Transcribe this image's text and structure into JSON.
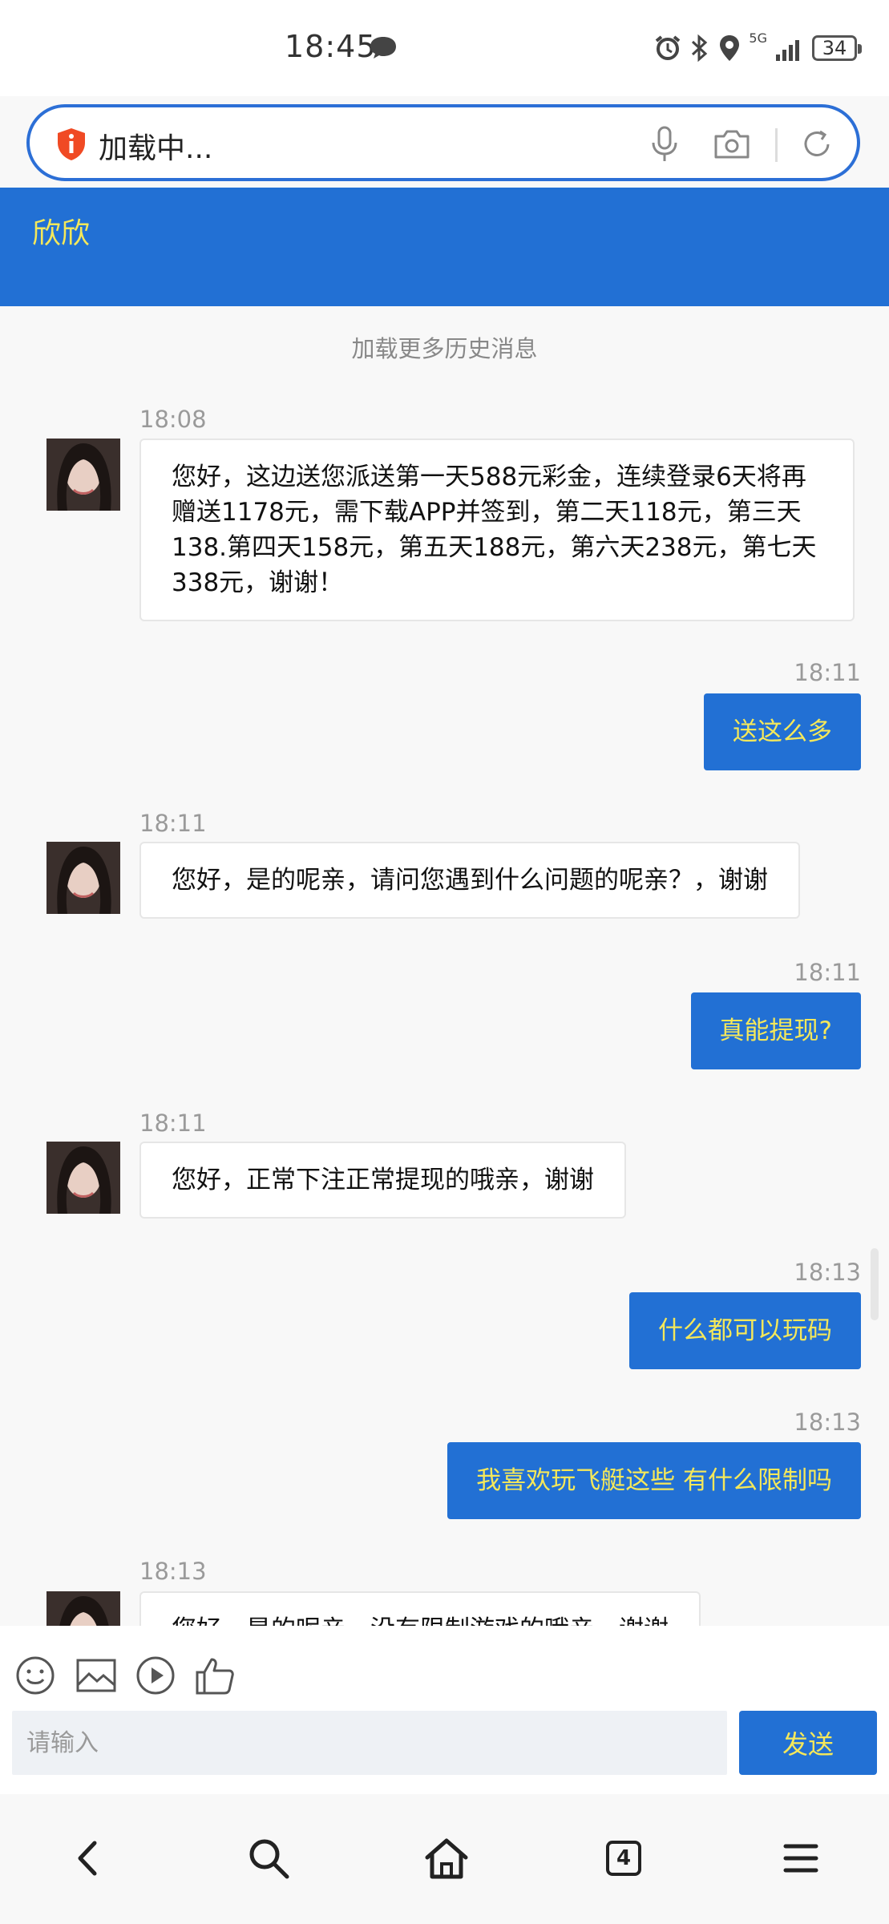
{
  "status_bar": {
    "time": "18:45",
    "network": "5G",
    "battery": "34",
    "icons": [
      "message-icon",
      "alarm-icon",
      "bluetooth-icon",
      "location-icon",
      "signal-icon",
      "battery-icon"
    ]
  },
  "browser": {
    "address_text": "加载中...",
    "tab_count": "4"
  },
  "chat": {
    "title": "欣欣",
    "load_more": "加载更多历史消息",
    "messages": [
      {
        "direction": "in",
        "time": "18:08",
        "text": "您好，这边送您派送第一天588元彩金，连续登录6天将再赠送1178元，需下载APP并签到，第二天118元，第三天138.第四天158元，第五天188元，第六天238元，第七天338元，谢谢！"
      },
      {
        "direction": "out",
        "time": "18:11",
        "text": "送这么多"
      },
      {
        "direction": "in",
        "time": "18:11",
        "text": "您好，是的呢亲，请问您遇到什么问题的呢亲？，谢谢"
      },
      {
        "direction": "out",
        "time": "18:11",
        "text": "真能提现?"
      },
      {
        "direction": "in",
        "time": "18:11",
        "text": "您好，正常下注正常提现的哦亲，谢谢"
      },
      {
        "direction": "out",
        "time": "18:13",
        "text": "什么都可以玩码"
      },
      {
        "direction": "out",
        "time": "18:13",
        "text": "我喜欢玩飞艇这些 有什么限制吗"
      },
      {
        "direction": "in",
        "time": "18:13",
        "text": "您好，是的呢亲，没有限制游戏的哦亲，谢谢"
      }
    ]
  },
  "composer": {
    "placeholder": "请输入",
    "send_label": "发送",
    "tools": [
      "emoji-icon",
      "image-icon",
      "video-icon",
      "thumbs-up-icon"
    ]
  },
  "colors": {
    "brand_blue": "#2270d4",
    "accent_yellow": "#f5e85a"
  }
}
